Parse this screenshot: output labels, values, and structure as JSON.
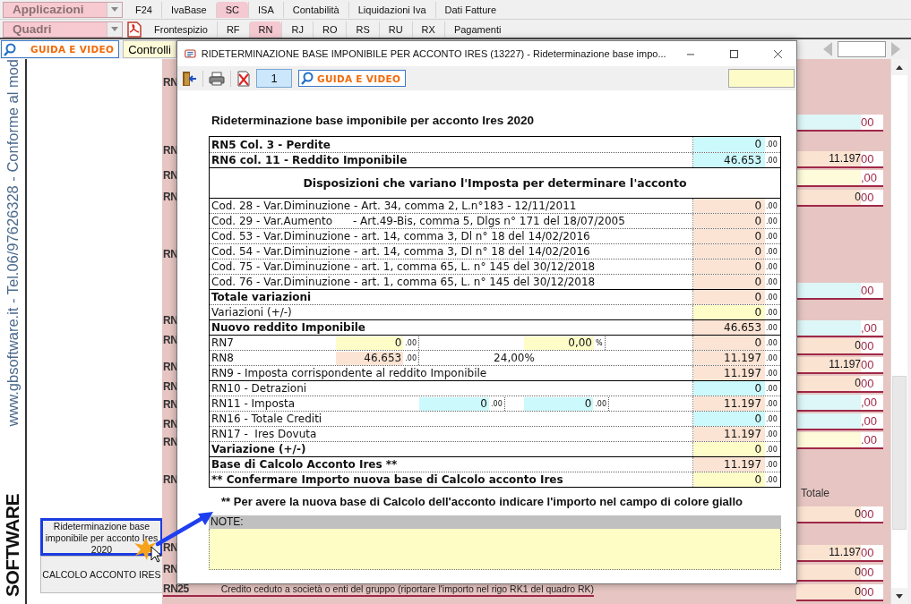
{
  "toolbar": {
    "applications": {
      "label": "Applicazioni"
    },
    "panels": {
      "label": "Quadri"
    },
    "sections": [
      {
        "label": "F24",
        "selected": false
      },
      {
        "label": "IvaBase",
        "selected": false
      },
      {
        "label": "SC",
        "selected": true
      },
      {
        "label": "ISA",
        "selected": false
      },
      {
        "label": "Contabilità",
        "selected": false
      },
      {
        "label": "Liquidazioni Iva",
        "selected": false
      },
      {
        "label": "Dati Fatture",
        "selected": false
      }
    ],
    "pages": [
      {
        "label": "Frontespizio",
        "selected": false
      },
      {
        "label": "RF",
        "selected": false
      },
      {
        "label": "RN",
        "selected": true
      },
      {
        "label": "RJ",
        "selected": false
      },
      {
        "label": "RO",
        "selected": false
      },
      {
        "label": "RS",
        "selected": false
      },
      {
        "label": "RU",
        "selected": false
      },
      {
        "label": "RX",
        "selected": false
      },
      {
        "label": "Pagamenti",
        "selected": false
      }
    ],
    "guide_button": "GUIDA E VIDEO",
    "checks_button": "Controlli"
  },
  "sidebar": {
    "tagline": "www.gbsoftware.it - Tel.06/97626328 - Conforme al mod",
    "brand": "SOFTWARE",
    "buttons": [
      {
        "label": "Rideterminazione base imponibile per acconto Ires 2020",
        "highlighted": true
      },
      {
        "label": "CALCOLO ACCONTO IRES",
        "highlighted": false
      }
    ]
  },
  "form": {
    "codes": [
      "RN",
      "RN",
      "RN",
      "RN",
      "RN",
      "RN",
      "RN",
      "RN",
      "RN",
      "RN",
      "RN",
      "RN",
      "RN",
      "RN",
      "RN"
    ],
    "fields": [
      {
        "color": "#ddf6f8",
        "decimals": "00"
      },
      {
        "color": "#fbe3d2",
        "amount": "11.197",
        "decimals": "00"
      },
      {
        "color": "#fdfbd9",
        "decimals": ",00"
      },
      {
        "color": "#fbe3d2",
        "amount": "0",
        "decimals": "00"
      },
      {
        "color": "#ddf6f8",
        "decimals": "00"
      },
      {
        "color": "#ddf6f8",
        "decimals": ",00"
      },
      {
        "color": "#fbe3d2",
        "amount": "0",
        "decimals": "00"
      },
      {
        "color": "#fbe3d2",
        "amount": "11.197",
        "decimals": "00"
      },
      {
        "color": "#fbe3d2",
        "amount": "0",
        "decimals": "00"
      },
      {
        "color": "#ddf6f8",
        "decimals": ",00"
      },
      {
        "color": "#ddf6f8",
        "decimals": ",00"
      },
      {
        "color": "#fdfbd9",
        "decimals": ".00"
      },
      {
        "color": "#fbe3d2",
        "amount": "0",
        "decimals": "00"
      },
      {
        "color": "#fbe3d2",
        "amount": "11.197",
        "decimals": "00"
      },
      {
        "color": "#fbe3d2",
        "amount": "0",
        "decimals": "00"
      },
      {
        "color": "#fbe3d2",
        "amount": "0",
        "decimals": "00"
      }
    ],
    "totals_label": "Totale",
    "footer": {
      "code": "RN25",
      "text": "Credito ceduto a società o enti del gruppo (riportare l'importo nel rigo RK1 del quadro RK)"
    }
  },
  "dialog": {
    "title": "RIDETERMINAZIONE BASE IMPONIBILE PER ACCONTO IRES (13227) - Rideterminazione base impo...",
    "page": "1",
    "guide_button": "GUIDA E VIDEO",
    "heading": "Rideterminazione base imponibile per acconto Ires 2020",
    "table": {
      "rows": [
        {
          "kind": "value",
          "label": "RN5 Col. 3 - Perdite",
          "bold": true,
          "group_start": false,
          "value": "0",
          "decimals": ".00",
          "color": "#ccf9fb"
        },
        {
          "kind": "value",
          "label": "RN6 col. 11 - Reddito Imponibile",
          "bold": true,
          "group_start": false,
          "value": "46.653",
          "decimals": ".00",
          "color": "#ccf9fb"
        },
        {
          "kind": "header",
          "label": "Disposizioni che variano l'Imposta per determinare l'acconto"
        },
        {
          "kind": "value",
          "label": "Cod. 28 - Var.Diminuzione - Art. 34, comma 2, L.n°183 - 12/11/2011",
          "bold": false,
          "group_start": true,
          "value": "0",
          "decimals": ".00",
          "color": "#fce4d4"
        },
        {
          "kind": "value",
          "label": "Cod. 29 - Var.Aumento      - Art.49-Bis, comma 5, Dlgs n° 171 del 18/07/2005",
          "bold": false,
          "group_start": false,
          "value": "0",
          "decimals": ".00",
          "color": "#fce4d4"
        },
        {
          "kind": "value",
          "label": "Cod. 53 - Var.Diminuzione - art. 14, comma 3, Dl n° 18 del 14/02/2016",
          "bold": false,
          "group_start": false,
          "value": "0",
          "decimals": ".00",
          "color": "#fce4d4"
        },
        {
          "kind": "value",
          "label": "Cod. 54 - Var.Diminuzione - art. 14, comma 3, Dl n° 18 del 14/02/2016",
          "bold": false,
          "group_start": false,
          "value": "0",
          "decimals": ".00",
          "color": "#fce4d4"
        },
        {
          "kind": "value",
          "label": "Cod. 75 - Var.Diminuzione - art. 1, comma 65, L. n° 145 del 30/12/2018",
          "bold": false,
          "group_start": false,
          "value": "0",
          "decimals": ".00",
          "color": "#fce4d4"
        },
        {
          "kind": "value",
          "label": "Cod. 76 - Var.Diminuzione - art. 1, comma 65, L. n° 145 del 30/12/2018",
          "bold": false,
          "group_start": false,
          "value": "0",
          "decimals": ".00",
          "color": "#fce4d4"
        },
        {
          "kind": "value",
          "label": "Totale variazioni",
          "bold": true,
          "group_start": true,
          "value": "0",
          "decimals": ".00",
          "color": "#fce4d4"
        },
        {
          "kind": "value",
          "label": "Variazioni (+/-)",
          "bold": false,
          "group_start": false,
          "value": "0",
          "decimals": ".00",
          "color": "#fefdc8"
        },
        {
          "kind": "value",
          "label": "Nuovo reddito Imponibile",
          "bold": true,
          "group_start": true,
          "value": "46.653",
          "decimals": ".00",
          "color": "#fce4d4"
        },
        {
          "kind": "value",
          "label": "RN7",
          "bold": false,
          "group_start": true,
          "value": "0",
          "decimals": ".00",
          "color": "#fce4d4",
          "extras": {
            "first": {
              "kind": "field",
              "value": "0",
              "decimals": ".00",
              "color": "#fefdc8"
            },
            "third": {
              "kind": "field",
              "value": "0,00",
              "decimals": "%",
              "color": "#fefdc8"
            }
          }
        },
        {
          "kind": "value",
          "label": "RN8",
          "bold": false,
          "group_start": false,
          "value": "11.197",
          "decimals": ".00",
          "color": "#fce4d4",
          "extras": {
            "first": {
              "kind": "field",
              "value": "46.653",
              "decimals": ".00",
              "color": "#fce4d4"
            },
            "second": {
              "kind": "text",
              "value": "24,00%"
            }
          }
        },
        {
          "kind": "value",
          "label": "RN9 - Imposta corrispondente al reddito Imponibile",
          "bold": false,
          "group_start": false,
          "value": "11.197",
          "decimals": ".00",
          "color": "#fce4d4"
        },
        {
          "kind": "value",
          "label": "RN10 - Detrazioni",
          "bold": false,
          "group_start": true,
          "value": "0",
          "decimals": ".00",
          "color": "#ccf9fb"
        },
        {
          "kind": "value",
          "label": "RN11 - Imposta",
          "bold": false,
          "group_start": false,
          "value": "11.197",
          "decimals": ".00",
          "color": "#fce4d4",
          "extras": {
            "second": {
              "kind": "field",
              "value": "0",
              "decimals": ".00",
              "color": "#ccf9fb"
            },
            "third": {
              "kind": "field",
              "value": "0",
              "decimals": ".00",
              "color": "#ccf9fb"
            }
          }
        },
        {
          "kind": "value",
          "label": "RN16 - Totale Crediti",
          "bold": false,
          "group_start": false,
          "value": "0",
          "decimals": ".00",
          "color": "#ccf9fb"
        },
        {
          "kind": "value",
          "label": "RN17 -  Ires Dovuta",
          "bold": false,
          "group_start": false,
          "value": "11.197",
          "decimals": ".00",
          "color": "#fce4d4"
        },
        {
          "kind": "value",
          "label": "Variazione (+/-)",
          "bold": true,
          "group_start": false,
          "value": "0",
          "decimals": ".00",
          "color": "#fefdc8"
        },
        {
          "kind": "value",
          "label": "Base di Calcolo Acconto Ires **",
          "bold": true,
          "group_start": true,
          "value": "11.197",
          "decimals": ".00",
          "color": "#fce4d4"
        },
        {
          "kind": "value",
          "label": "** Confermare Importo nuova base di Calcolo acconto Ires",
          "bold": true,
          "group_start": false,
          "value": "0",
          "decimals": ".00",
          "color": "#fefdc8"
        }
      ]
    },
    "note": "** Per avere la nuova base di Calcolo dell'acconto indicare l'importo nel campo di colore giallo",
    "notes_label": "NOTE:"
  }
}
